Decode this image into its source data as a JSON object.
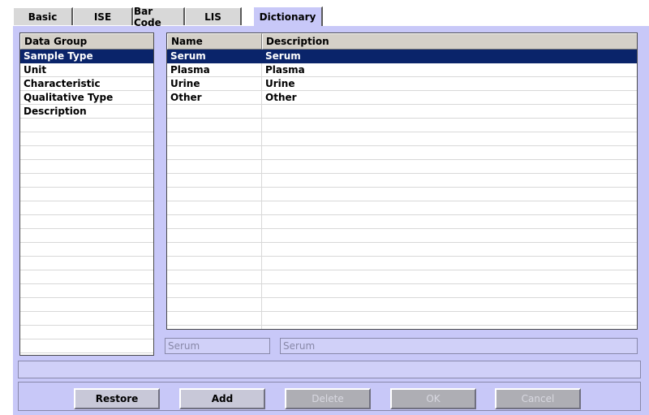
{
  "tabs": [
    {
      "label": "Basic",
      "active": false
    },
    {
      "label": "ISE",
      "active": false
    },
    {
      "label": "Bar Code",
      "active": false
    },
    {
      "label": "LIS",
      "active": false
    },
    {
      "label": "Dictionary",
      "active": true
    }
  ],
  "data_group": {
    "header": "Data Group",
    "items": [
      "Sample Type",
      "Unit",
      "Characteristic",
      "Qualitative Type",
      "Description"
    ],
    "selected_index": 0
  },
  "entries": {
    "columns": [
      "Name",
      "Description"
    ],
    "rows": [
      {
        "name": "Serum",
        "description": "Serum"
      },
      {
        "name": "Plasma",
        "description": "Plasma"
      },
      {
        "name": "Urine",
        "description": "Urine"
      },
      {
        "name": "Other",
        "description": "Other"
      }
    ],
    "selected_index": 0
  },
  "edit": {
    "name_value": "Serum",
    "description_value": "Serum"
  },
  "buttons": {
    "restore": "Restore",
    "add": "Add",
    "delete": "Delete",
    "ok": "OK",
    "cancel": "Cancel"
  },
  "colors": {
    "panel_background": "#c8c8f8",
    "selection": "#0a246a"
  }
}
